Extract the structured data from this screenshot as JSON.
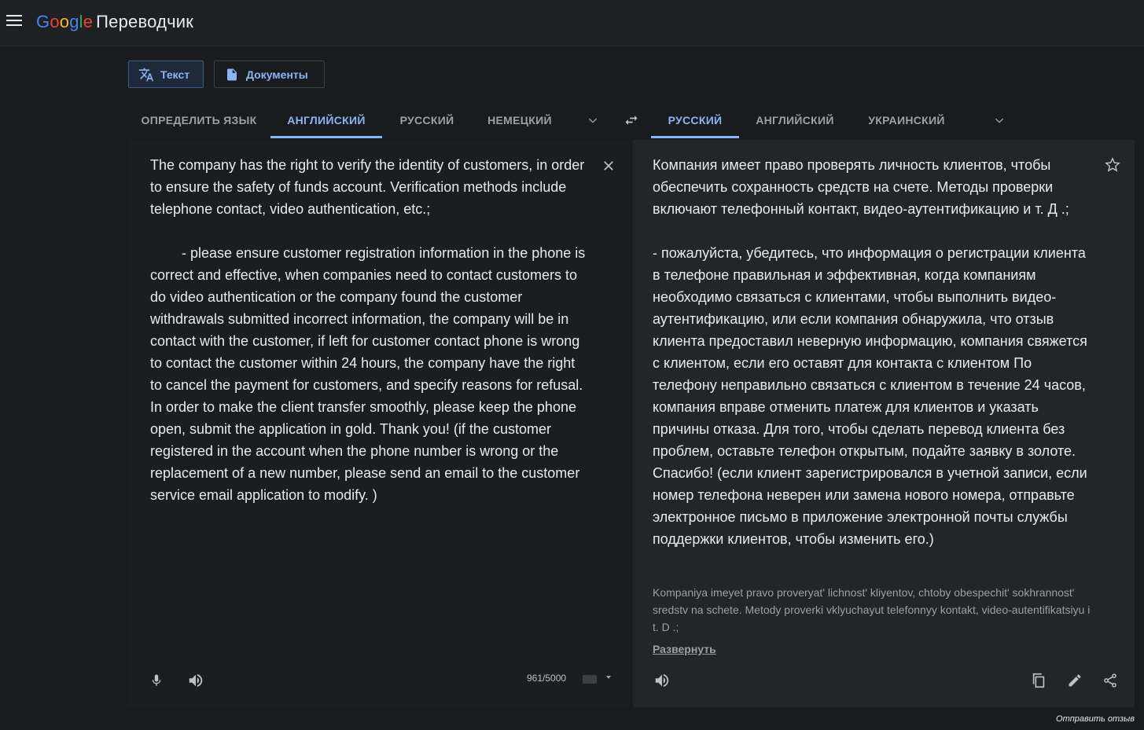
{
  "header": {
    "logo_text": "Google",
    "product_name": "Переводчик"
  },
  "modes": {
    "text_label": "Текст",
    "documents_label": "Документы"
  },
  "source_langs": [
    "ОПРЕДЕЛИТЬ ЯЗЫК",
    "АНГЛИЙСКИЙ",
    "РУССКИЙ",
    "НЕМЕЦКИЙ"
  ],
  "target_langs": [
    "РУССКИЙ",
    "АНГЛИЙСКИЙ",
    "УКРАИНСКИЙ"
  ],
  "source_text": "The company has the right to verify the identity of customers, in order to ensure the safety of funds account. Verification methods include telephone contact, video authentication, etc.;\n\n        - please ensure customer registration information in the phone is correct and effective, when companies need to contact customers to do video authentication or the company found the customer withdrawals submitted incorrect information, the company will be in contact with the customer, if left for customer contact phone is wrong to contact the customer within 24 hours, the company have the right to cancel the payment for customers, and specify reasons for refusal. In order to make the client transfer smoothly, please keep the phone open, submit the application in gold. Thank you! (if the customer registered in the account when the phone number is wrong or the replacement of a new number, please send an email to the customer service email application to modify. )",
  "translated_text": "Компания имеет право проверять личность клиентов, чтобы обеспечить сохранность средств на счете. Методы проверки включают телефонный контакт, видео-аутентификацию и т. Д .;\n\n- пожалуйста, убедитесь, что информация о регистрации клиента в телефоне правильная и эффективная, когда компаниям необходимо связаться с клиентами, чтобы выполнить видео-аутентификацию, или если компания обнаружила, что отзыв клиента предоставил неверную информацию, компания свяжется с клиентом, если его оставят для контакта с клиентом По телефону неправильно связаться с клиентом в течение 24 часов, компания вправе отменить платеж для клиентов и указать причины отказа. Для того, чтобы сделать перевод клиента без проблем, оставьте телефон открытым, подайте заявку в золоте. Спасибо! (если клиент зарегистрировался в учетной записи, если номер телефона неверен или замена нового номера, отправьте электронное письмо в приложение электронной почты службы поддержки клиентов, чтобы изменить его.)",
  "transliteration": "Kompaniya imeyet pravo proveryat' lichnost' kliyentov, chtoby obespechit' sokhrannost' sredstv na schete. Metody proverki vklyuchayut telefonnyy kontakt, video-autentifikatsiyu i t. D .;",
  "expand_label": "Развернуть",
  "char_count": "961/5000",
  "feedback_label": "Отправить отзыв",
  "icons": {
    "menu": "menu-icon",
    "translate": "translate-icon",
    "document": "document-icon",
    "swap": "swap-icon",
    "clear": "close-icon",
    "star": "star-icon",
    "mic": "mic-icon",
    "speaker": "speaker-icon",
    "copy": "copy-icon",
    "edit": "pencil-icon",
    "share": "share-icon"
  },
  "colors": {
    "accent": "#8ab4f8",
    "background": "#1a1b1d"
  }
}
